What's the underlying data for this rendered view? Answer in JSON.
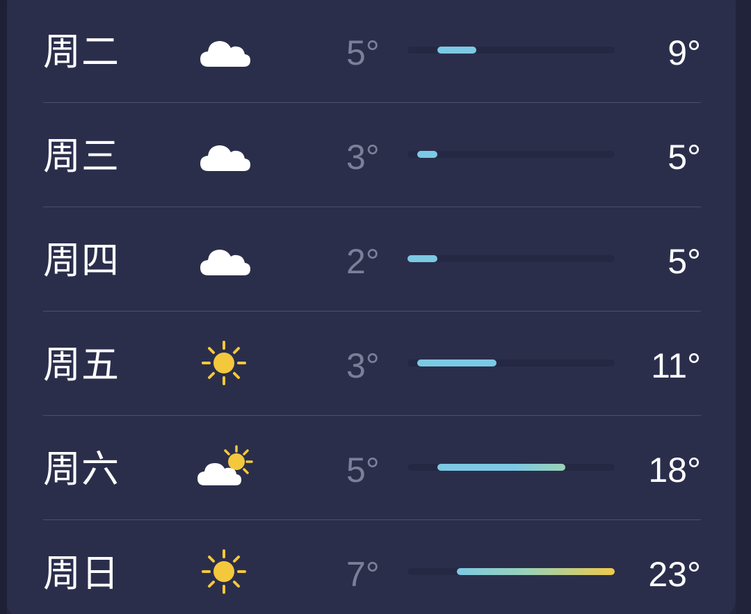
{
  "forecast": [
    {
      "day": "周二",
      "icon": "cloud-icon",
      "low": "5°",
      "high": "9°",
      "range": [
        5,
        9
      ]
    },
    {
      "day": "周三",
      "icon": "cloud-icon",
      "low": "3°",
      "high": "5°",
      "range": [
        3,
        5
      ]
    },
    {
      "day": "周四",
      "icon": "cloud-icon",
      "low": "2°",
      "high": "5°",
      "range": [
        2,
        5
      ]
    },
    {
      "day": "周五",
      "icon": "sun-icon",
      "low": "3°",
      "high": "11°",
      "range": [
        3,
        11
      ]
    },
    {
      "day": "周六",
      "icon": "partly-cloudy-icon",
      "low": "5°",
      "high": "18°",
      "range": [
        5,
        18
      ]
    },
    {
      "day": "周日",
      "icon": "sun-icon",
      "low": "7°",
      "high": "23°",
      "range": [
        7,
        23
      ]
    }
  ],
  "week_range": [
    2,
    23
  ],
  "colors": {
    "cool": "#7cc9e3",
    "mild": "#9ad2b6",
    "warm": "#f0c94a",
    "low_text": "#7c7f98",
    "high_text": "#ffffff",
    "background": "#2b2e4b"
  }
}
